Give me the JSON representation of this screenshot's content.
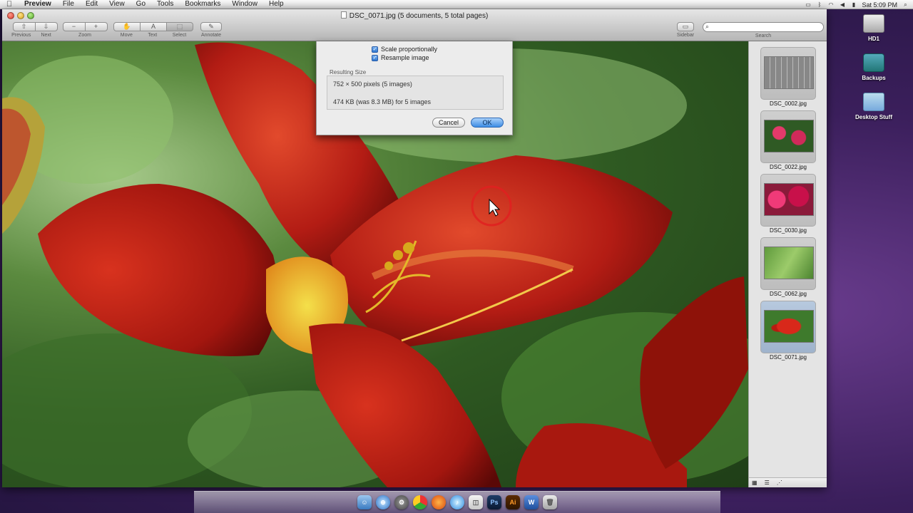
{
  "menubar": {
    "apple": "",
    "items": [
      "Preview",
      "File",
      "Edit",
      "View",
      "Go",
      "Tools",
      "Bookmarks",
      "Window",
      "Help"
    ],
    "clock": "Sat 5:09 PM",
    "status_icons": [
      "screen-icon",
      "bluetooth-icon",
      "wifi-icon",
      "volume-icon",
      "battery-icon",
      "spotlight-icon"
    ]
  },
  "desktop": {
    "icons": [
      {
        "label": "HD1",
        "icon": "hard-drive-icon"
      },
      {
        "label": "Backups",
        "icon": "time-machine-icon"
      },
      {
        "label": "Desktop Stuff",
        "icon": "folder-icon"
      }
    ]
  },
  "window": {
    "title": "DSC_0071.jpg (5 documents, 5 total pages)",
    "toolbar": {
      "previous": "Previous",
      "next": "Next",
      "zoom": "Zoom",
      "move": "Move",
      "text": "Text",
      "select": "Select",
      "annotate": "Annotate",
      "sidebar": "Sidebar",
      "search": "Search",
      "text_glyph": "A",
      "zoom_out_glyph": "−",
      "zoom_in_glyph": "+"
    }
  },
  "dialog": {
    "scale_proportionally": "Scale proportionally",
    "resample_image": "Resample image",
    "resulting_size_label": "Resulting Size",
    "pixels_line": "752 × 500 pixels (5 images)",
    "size_line": "474 KB (was 8.3 MB) for 5 images",
    "cancel": "Cancel",
    "ok": "OK"
  },
  "sidebar": {
    "thumbnails": [
      {
        "name": "DSC_0002.jpg",
        "pic": "keyboard"
      },
      {
        "name": "DSC_0022.jpg",
        "pic": "pink-flowers"
      },
      {
        "name": "DSC_0030.jpg",
        "pic": "red-pink-flowers"
      },
      {
        "name": "DSC_0062.jpg",
        "pic": "green-leaf"
      },
      {
        "name": "DSC_0071.jpg",
        "pic": "red-lily"
      }
    ]
  },
  "dock": {
    "icons": [
      "finder-icon",
      "safari-icon",
      "system-prefs-icon",
      "chrome-icon",
      "firefox-icon",
      "itunes-icon",
      "preview-icon",
      "photoshop-icon",
      "illustrator-icon",
      "word-icon",
      "trash-icon"
    ],
    "ps_label": "Ps",
    "ai_label": "Ai",
    "word_label": "W"
  }
}
